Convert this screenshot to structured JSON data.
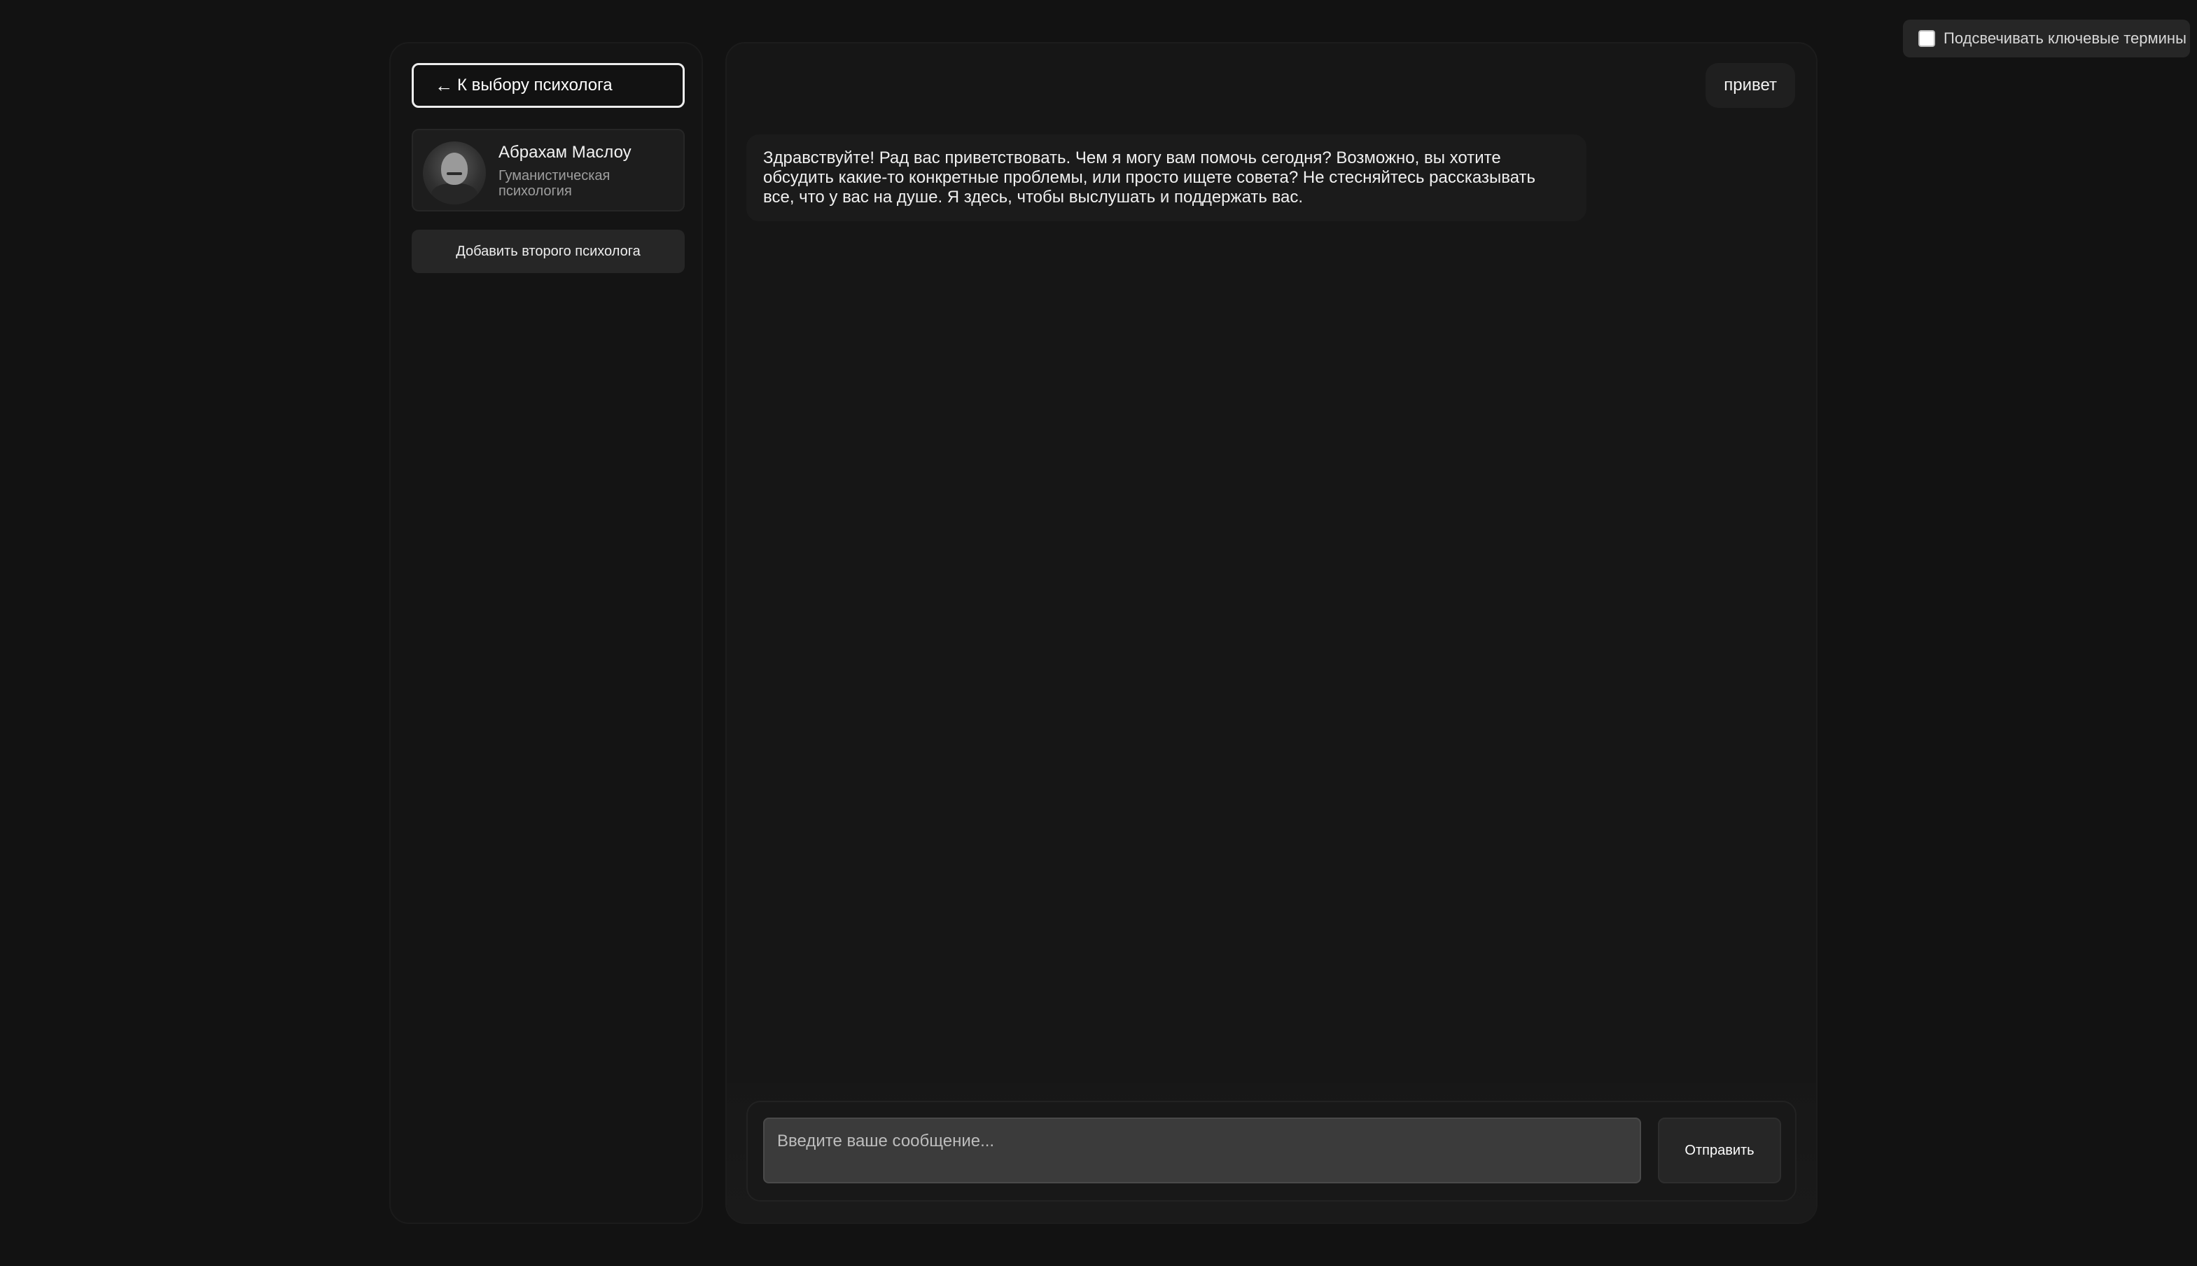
{
  "settings": {
    "highlight_terms_label": "Подсвечивать ключевые термины",
    "highlight_terms_checked": false
  },
  "sidebar": {
    "back_label": "К выбору психолога",
    "back_icon": "arrow-left-icon",
    "psychologist": {
      "name": "Абрахам Маслоу",
      "school": "Гуманистическая психология"
    },
    "add_second_label": "Добавить второго психолога"
  },
  "chat": {
    "messages": [
      {
        "role": "user",
        "text": "привет"
      },
      {
        "role": "assistant",
        "text": "Здравствуйте! Рад вас приветствовать. Чем я могу вам помочь сегодня? Возможно, вы хотите обсудить какие-то конкретные проблемы, или просто ищете совета? Не стесняйтесь рассказывать все, что у вас на душе. Я здесь, чтобы выслушать и поддержать вас."
      }
    ],
    "input_placeholder": "Введите ваше сообщение...",
    "send_label": "Отправить"
  },
  "colors": {
    "background": "#121212",
    "panel": "#161616",
    "surface": "#262626"
  }
}
